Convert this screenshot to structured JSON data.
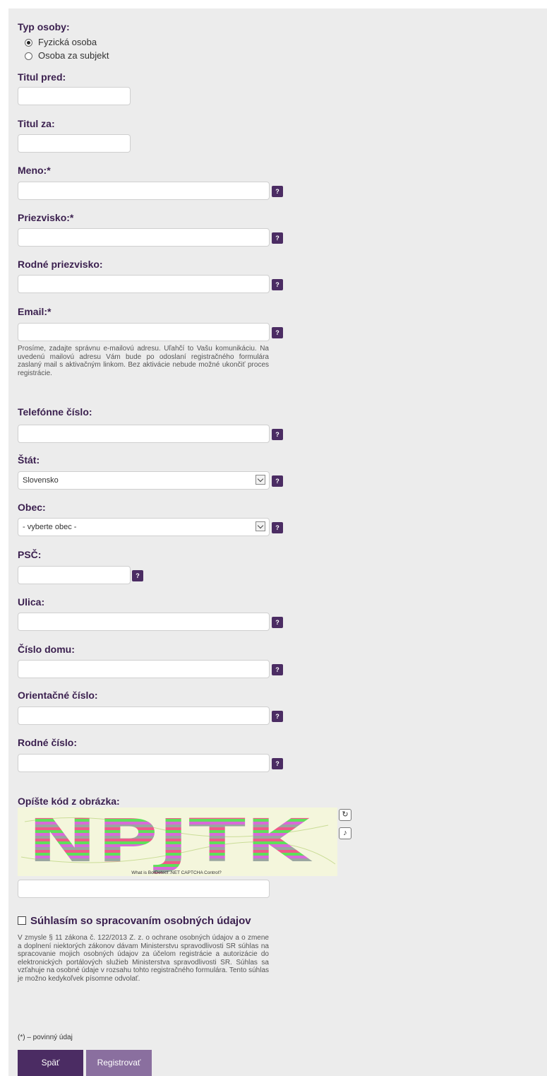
{
  "person_type": {
    "label": "Typ osoby:",
    "options": [
      "Fyzická osoba",
      "Osoba za subjekt"
    ],
    "selected": "Fyzická osoba"
  },
  "fields": {
    "titul_pred": "Titul pred:",
    "titul_za": "Titul za:",
    "meno": "Meno:*",
    "priezvisko": "Priezvisko:*",
    "rodne_priezvisko": "Rodné priezvisko:",
    "email": "Email:*",
    "telefon": "Telefónne číslo:",
    "stat": "Štát:",
    "obec": "Obec:",
    "psc": "PSČ:",
    "ulica": "Ulica:",
    "cislo_domu": "Číslo domu:",
    "orientacne_cislo": "Orientačné číslo:",
    "rodne_cislo": "Rodné číslo:"
  },
  "help_icon": "?",
  "email_note": "Prosíme, zadajte správnu e-mailovú adresu. Uľahčí to Vašu komunikáciu. Na uvedenú mailovú adresu Vám bude po odoslaní registračného formulára zaslaný mail s aktivačným linkom. Bez aktivácie nebude možné ukončiť proces registrácie.",
  "stat_value": "Slovensko",
  "obec_value": "- vyberte obec -",
  "captcha": {
    "label": "Opíšte kód z obrázka:",
    "code": "NPJTK",
    "caption": "What is BotDetect .NET CAPTCHA Control?",
    "reload_icon": "reload-icon",
    "sound_icon": "sound-icon"
  },
  "consent": {
    "title": "Súhlasím so spracovaním osobných údajov",
    "text": "V zmysle § 11 zákona č. 122/2013 Z. z. o ochrane osobných údajov a o zmene a doplnení niektorých zákonov dávam Ministerstvu spravodlivosti SR súhlas na spracovanie mojich osobných údajov za účelom registrácie a autorizácie do elektronických portálových služieb Ministerstva spravodlivosti SR. Súhlas sa vzťahuje na osobné údaje v rozsahu tohto registračného formulára. Tento súhlas je možno kedykoľvek písomne odvolať."
  },
  "required_note": "(*) – povinný údaj",
  "buttons": {
    "back": "Späť",
    "register": "Registrovať"
  },
  "colors": {
    "primary": "#4b2c63",
    "secondary": "#8a6f9f",
    "panel": "#ececec"
  }
}
